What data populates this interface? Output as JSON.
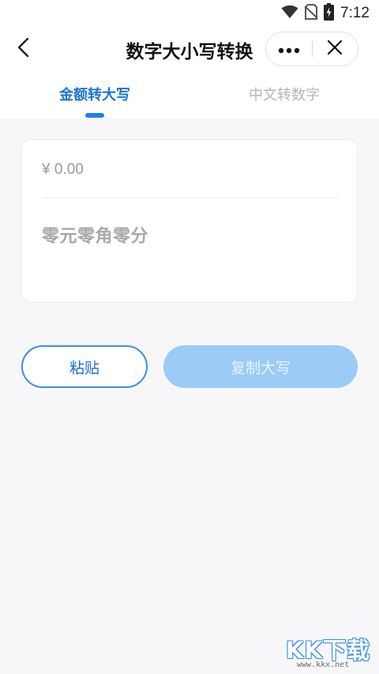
{
  "status_bar": {
    "time": "7:12",
    "icons": [
      "wifi-icon",
      "no-sim-icon",
      "battery-charging-icon"
    ]
  },
  "nav": {
    "title": "数字大小写转换",
    "back_icon": "chevron-left-icon",
    "more_icon": "more-dots-icon",
    "close_icon": "close-icon"
  },
  "tabs": [
    {
      "label": "金额转大写",
      "active": true
    },
    {
      "label": "中文转数字",
      "active": false
    }
  ],
  "converter": {
    "amount_value": "",
    "amount_placeholder": "¥ 0.00",
    "result_text": "零元零角零分"
  },
  "actions": {
    "paste_label": "粘贴",
    "copy_label": "复制大写"
  },
  "watermark": {
    "main": "KK下载",
    "sub": "www.kkx.net"
  },
  "colors": {
    "accent": "#1976d2",
    "indicator": "#1a7ff0",
    "copy_button_disabled": "#9ccbf7",
    "background": "#f7f7f9"
  }
}
